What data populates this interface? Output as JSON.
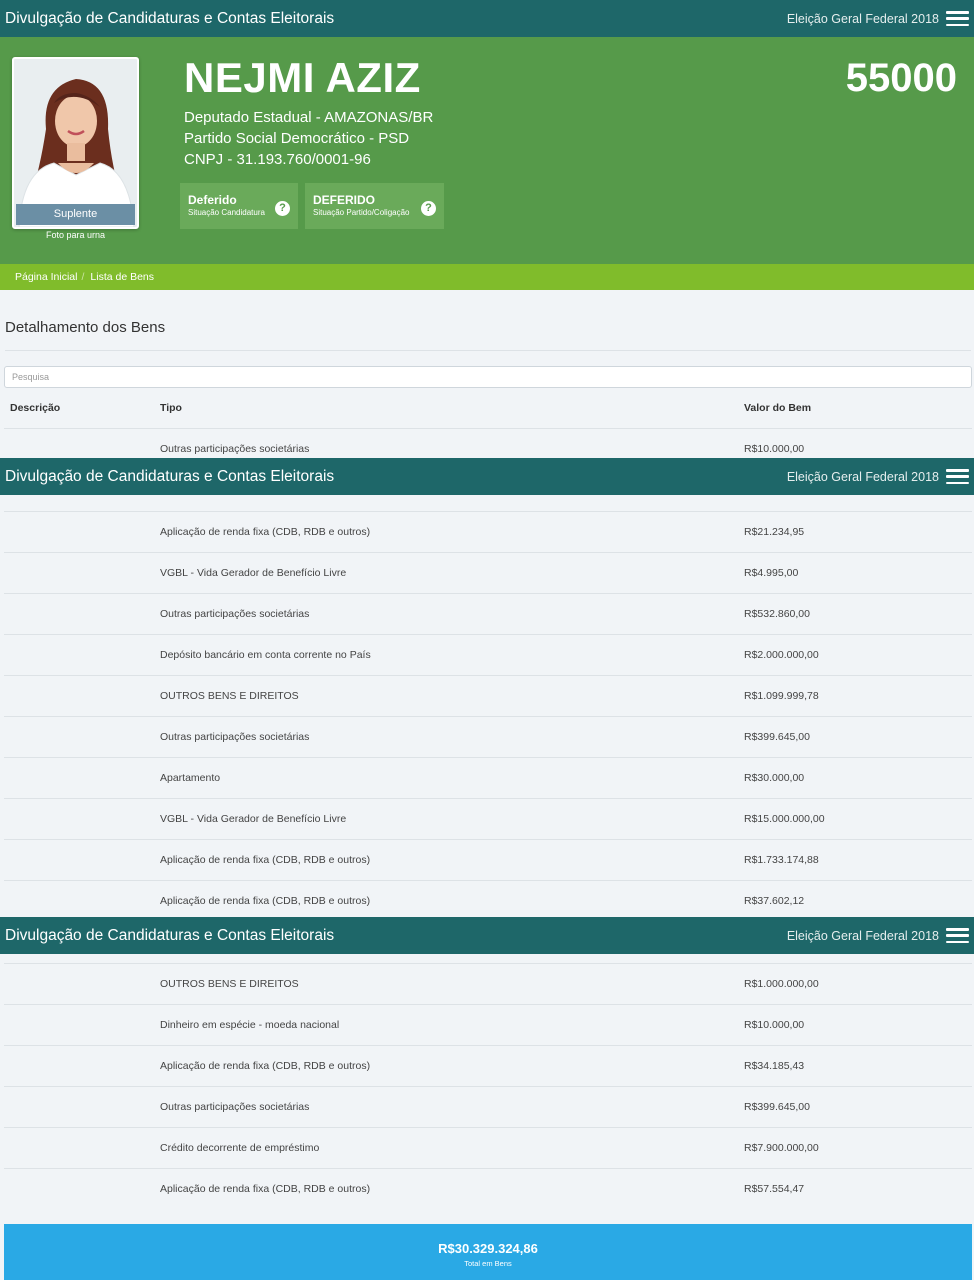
{
  "header": {
    "site_title": "Divulgação de Candidaturas e Contas Eleitorais",
    "election": "Eleição Geral Federal 2018"
  },
  "candidate": {
    "name": "NEJMI AZIZ",
    "number": "55000",
    "role": "Deputado Estadual - AMAZONAS/BR",
    "party": "Partido Social Democrático - PSD",
    "cnpj": "CNPJ - 31.193.760/0001-96",
    "photo_badge": "Suplente",
    "photo_caption": "Foto para urna",
    "status_candidatura": {
      "title": "Deferido",
      "sub": "Situação Candidatura"
    },
    "status_partido": {
      "title": "DEFERIDO",
      "sub": "Situação Partido/Coligação"
    }
  },
  "breadcrumb": {
    "home": "Página Inicial",
    "current": "Lista de Bens"
  },
  "assets": {
    "section_title": "Detalhamento dos Bens",
    "search_placeholder": "Pesquisa",
    "columns": {
      "descricao": "Descrição",
      "tipo": "Tipo",
      "valor": "Valor do Bem"
    },
    "rows": [
      {
        "tipo": "Outras participações societárias",
        "valor": "R$10.000,00"
      },
      {
        "tipo": "Aplicação de renda fixa (CDB, RDB e outros)",
        "valor": "R$21.234,95"
      },
      {
        "tipo": "VGBL - Vida Gerador de Benefício Livre",
        "valor": "R$4.995,00"
      },
      {
        "tipo": "Outras participações societárias",
        "valor": "R$532.860,00"
      },
      {
        "tipo": "Depósito bancário em conta corrente no País",
        "valor": "R$2.000.000,00"
      },
      {
        "tipo": "OUTROS BENS E DIREITOS",
        "valor": "R$1.099.999,78"
      },
      {
        "tipo": "Outras participações societárias",
        "valor": "R$399.645,00"
      },
      {
        "tipo": "Apartamento",
        "valor": "R$30.000,00"
      },
      {
        "tipo": "VGBL - Vida Gerador de Benefício Livre",
        "valor": "R$15.000.000,00"
      },
      {
        "tipo": "Aplicação de renda fixa (CDB, RDB e outros)",
        "valor": "R$1.733.174,88"
      },
      {
        "tipo": "Aplicação de renda fixa (CDB, RDB e outros)",
        "valor": "R$37.602,12"
      },
      {
        "tipo": "OUTROS BENS E DIREITOS",
        "valor": "R$1.000.000,00"
      },
      {
        "tipo": "Dinheiro em espécie - moeda nacional",
        "valor": "R$10.000,00"
      },
      {
        "tipo": "Aplicação de renda fixa (CDB, RDB e outros)",
        "valor": "R$34.185,43"
      },
      {
        "tipo": "Outras participações societárias",
        "valor": "R$399.645,00"
      },
      {
        "tipo": "Crédito decorrente de empréstimo",
        "valor": "R$7.900.000,00"
      },
      {
        "tipo": "Aplicação de renda fixa (CDB, RDB e outros)",
        "valor": "R$57.554,47"
      }
    ],
    "total": {
      "amount": "R$30.329.324,86",
      "label": "Total em Bens"
    }
  }
}
